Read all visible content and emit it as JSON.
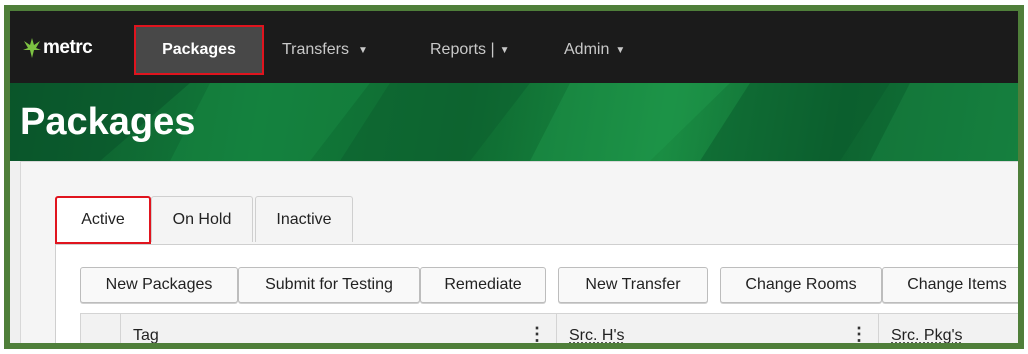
{
  "nav": {
    "logo_text": "metrc",
    "items": [
      {
        "label": "Packages",
        "caret": ""
      },
      {
        "label": "Transfers",
        "caret": "▼"
      },
      {
        "label": "Reports |",
        "caret": "▼"
      },
      {
        "label": "Admin",
        "caret": "▼"
      }
    ]
  },
  "page": {
    "title": "Packages"
  },
  "tabs": [
    {
      "label": "Active",
      "active": true
    },
    {
      "label": "On Hold",
      "active": false
    },
    {
      "label": "Inactive",
      "active": false
    }
  ],
  "toolbar": {
    "buttons": [
      {
        "label": "New Packages"
      },
      {
        "label": "Submit for Testing"
      },
      {
        "label": "Remediate"
      },
      {
        "label": "New Transfer"
      },
      {
        "label": "Change Rooms"
      },
      {
        "label": "Change Items"
      }
    ]
  },
  "table": {
    "columns": [
      {
        "label": ""
      },
      {
        "label": "Tag",
        "menu": "⋮"
      },
      {
        "label": "Src. H's",
        "menu": "⋮"
      },
      {
        "label": "Src. Pkg's"
      }
    ]
  },
  "colors": {
    "nav_bg": "#1b1b1b",
    "banner_green": "#127a3a",
    "highlight_red": "#e0141e",
    "frame_green": "#4f7f3a"
  }
}
